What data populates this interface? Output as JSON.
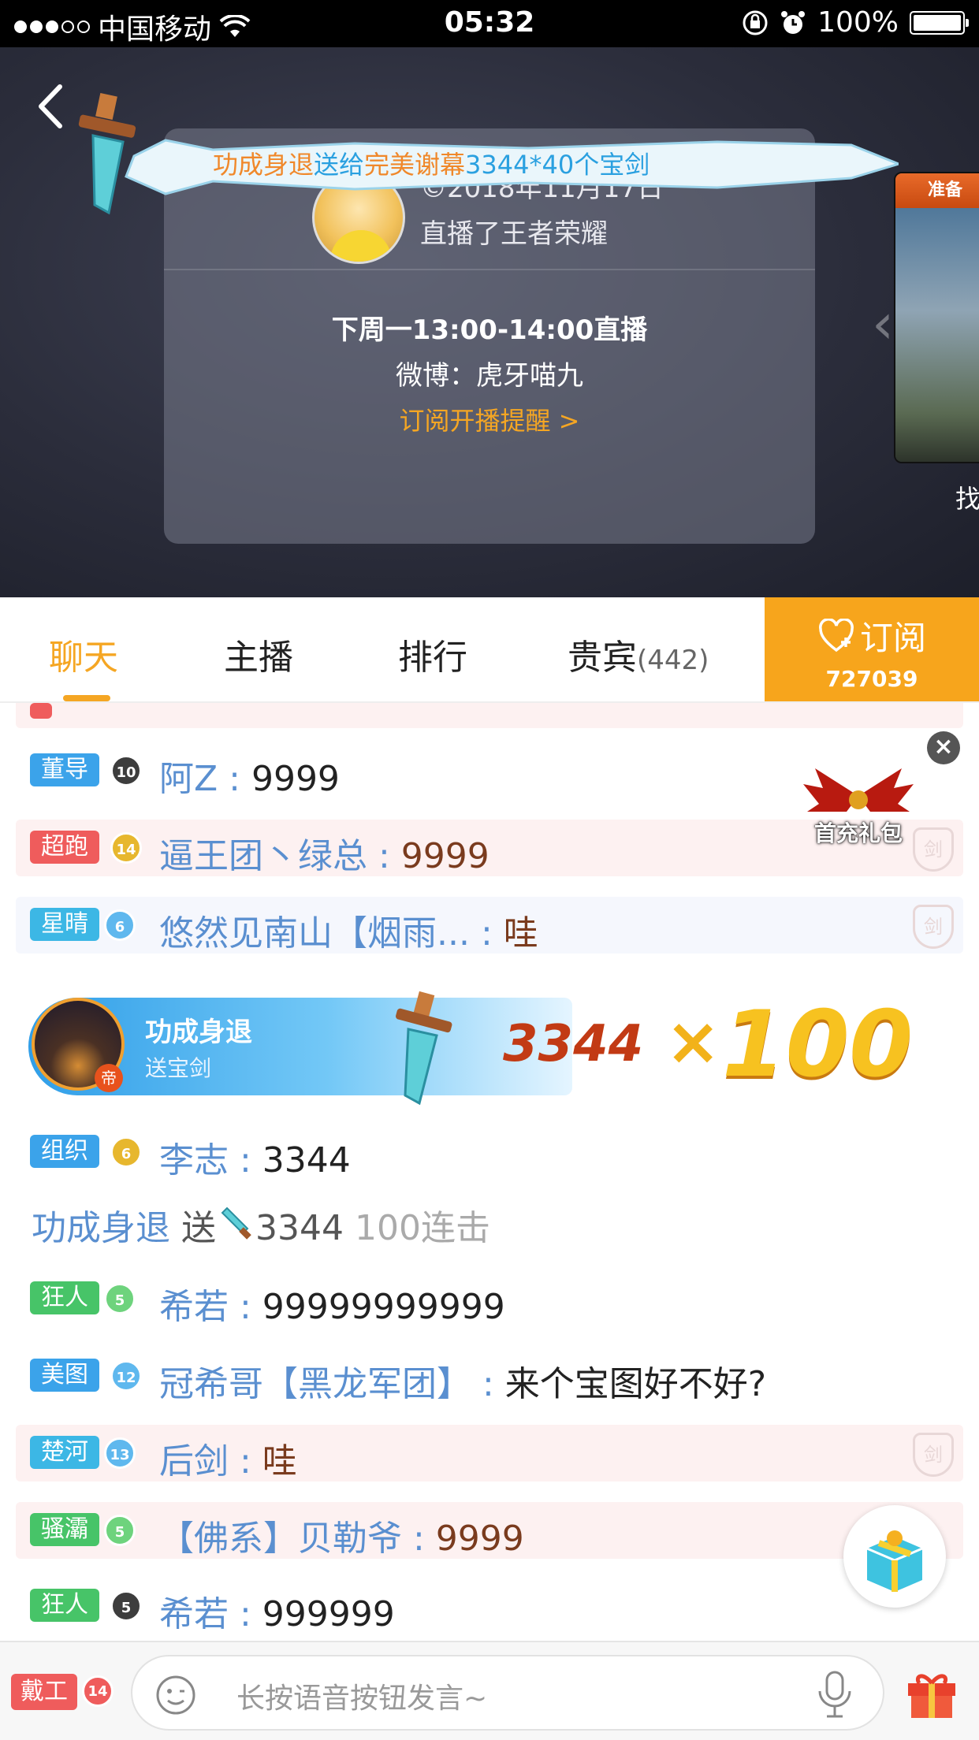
{
  "status_bar": {
    "carrier": "中国移动",
    "time": "05:32",
    "battery": "100%"
  },
  "player": {
    "gift_banner": {
      "sender": "功成身退",
      "action": "送给",
      "receiver": "完美谢幕",
      "gift": "3344*40个宝剑"
    },
    "card": {
      "date": "©2018年11月17日",
      "live_game": "直播了王者荣耀",
      "schedule": "下周一13:00-14:00直播",
      "weibo": "微博：虎牙喵九",
      "subscribe_reminder": "订阅开播提醒 >"
    },
    "side_card": {
      "header": "准备",
      "find": "找"
    }
  },
  "tabs": [
    {
      "label": "聊天"
    },
    {
      "label": "主播"
    },
    {
      "label": "排行"
    },
    {
      "label": "贵宾",
      "count": "(442)"
    }
  ],
  "subscribe": {
    "label": "订阅",
    "count": "727039"
  },
  "chat": {
    "messages": [
      {
        "badge": "董导",
        "level": "10",
        "nick": "阿Z",
        "text": "9999"
      },
      {
        "badge": "超跑",
        "level": "14",
        "nick": "逼王团丶绿总",
        "text": "9999"
      },
      {
        "badge": "星晴",
        "level": "6",
        "nick": "悠然见南山【烟雨...",
        "text": "哇"
      },
      {
        "badge": "组织",
        "level": "6",
        "nick": "李志",
        "text": "3344"
      },
      {
        "badge": "狂人",
        "level": "5",
        "nick": "希若",
        "text": "99999999999"
      },
      {
        "badge": "美图",
        "level": "12",
        "nick": "冠希哥【黑龙军团】",
        "text": "来个宝图好不好?"
      },
      {
        "badge": "楚河",
        "level": "13",
        "nick": "后剑",
        "text": "哇"
      },
      {
        "badge": "骚灞",
        "level": "5",
        "nick": "【佛系】贝勒爷",
        "text": "9999"
      },
      {
        "badge": "狂人",
        "level": "5",
        "nick": "希若",
        "text": "999999"
      }
    ],
    "gift_line": {
      "user": "功成身退",
      "send": "送",
      "count": "3344",
      "combo": "100连击"
    },
    "shield_glyph": "剑"
  },
  "first_pack": {
    "label": "首充礼包"
  },
  "combo_banner": {
    "name": "功成身退",
    "sub": "送宝剑",
    "tag": "帝",
    "number": "3344",
    "x": "×",
    "multiplier": "100"
  },
  "bottom": {
    "badge": "戴工",
    "level": "14",
    "placeholder": "长按语音按钮发言~"
  },
  "colors": {
    "accent": "#f5a623",
    "subscribe_bg": "#f7a51c",
    "nick": "#5a8fd0"
  }
}
